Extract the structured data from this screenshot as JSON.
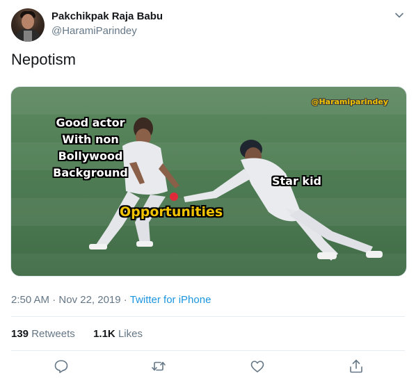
{
  "user": {
    "name": "Pakchikpak Raja Babu",
    "handle": "@HaramiParindey"
  },
  "tweet": {
    "text": "Nepotism"
  },
  "media": {
    "watermark": "@Haramiparindey",
    "caption_left": [
      "Good actor",
      "With non",
      "Bollywood",
      "Background"
    ],
    "caption_right": "Star kid",
    "caption_center": "Opportunities"
  },
  "meta": {
    "time": "2:50 AM",
    "sep": " · ",
    "date": "Nov 22, 2019",
    "sep2": " · ",
    "source": "Twitter for iPhone"
  },
  "stats": {
    "retweets_count": "139",
    "retweets_label": "Retweets",
    "likes_count": "1.1K",
    "likes_label": "Likes"
  },
  "icons": {
    "more": "chevron-down-icon",
    "reply": "reply-icon",
    "retweet": "retweet-icon",
    "like": "heart-icon",
    "share": "share-icon"
  },
  "colors": {
    "link": "#1b95e0",
    "secondary": "#657786",
    "caption_yellow": "#f2c400"
  }
}
